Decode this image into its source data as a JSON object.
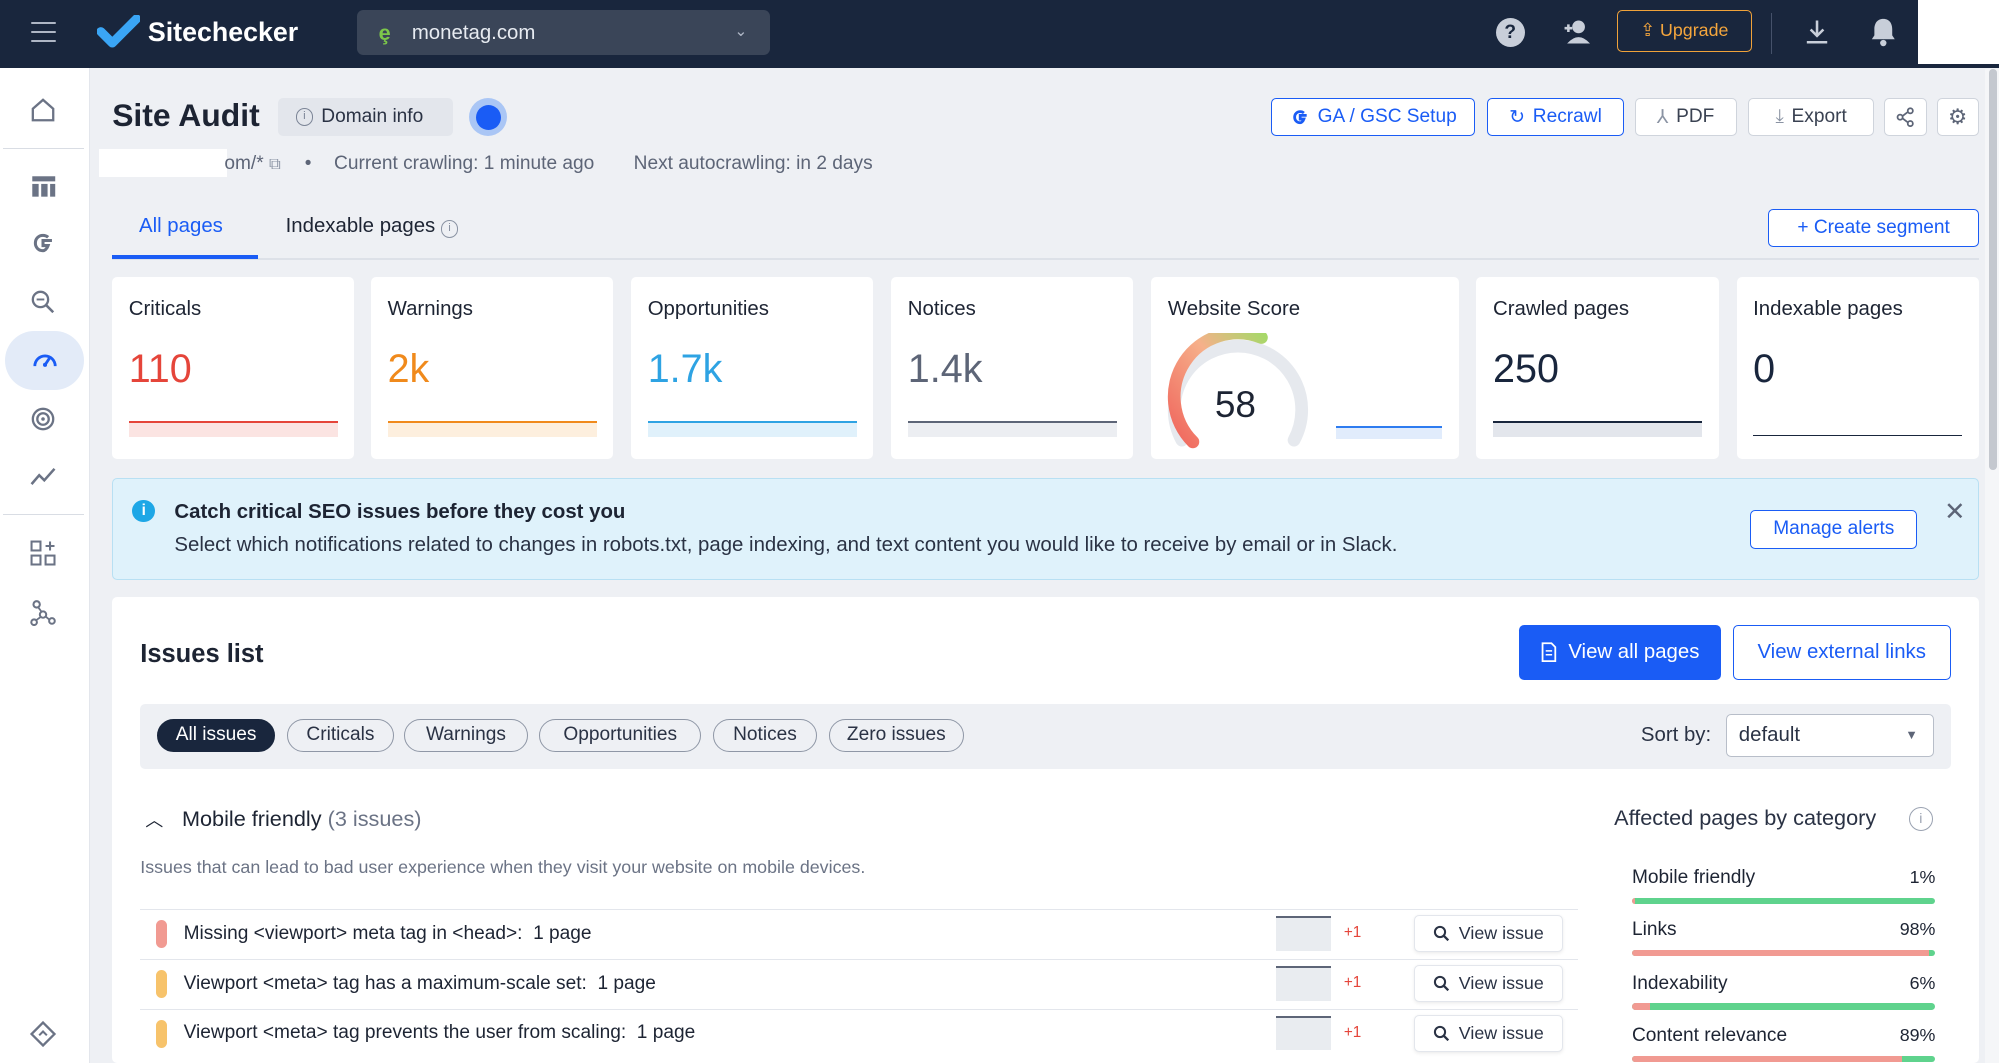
{
  "topbar": {
    "logo_text": "Sitechecker",
    "domain": "monetag.com",
    "upgrade_label": "Upgrade"
  },
  "sidebar": {
    "items": [
      "home-icon",
      "dashboard-icon",
      "google-icon",
      "keyword-search-icon",
      "site-audit-icon",
      "rank-tracker-icon",
      "analytics-icon",
      "apps-icon",
      "network-icon",
      "bottom-diamond-icon"
    ],
    "active_item": "site-audit-icon"
  },
  "header": {
    "title": "Site Audit",
    "domain_info_label": "Domain info",
    "url_suffix": "om/*",
    "current_crawling": "Current crawling: 1 minute ago",
    "next_autocrawling": "Next autocrawling: in 2 days",
    "buttons": {
      "ga_gsc": "GA / GSC Setup",
      "recrawl": "Recrawl",
      "pdf": "PDF",
      "export": "Export"
    }
  },
  "tabs": {
    "all_pages": "All pages",
    "indexable_pages": "Indexable pages",
    "create_segment": "+ Create segment"
  },
  "metrics": [
    {
      "label": "Criticals",
      "value": "110",
      "color": "#e5453a"
    },
    {
      "label": "Warnings",
      "value": "2k",
      "color": "#f08a1c"
    },
    {
      "label": "Opportunities",
      "value": "1.7k",
      "color": "#2ea3e3"
    },
    {
      "label": "Notices",
      "value": "1.4k",
      "color": "#5d6577"
    },
    {
      "label": "Website Score",
      "value": "58",
      "score_fraction": 0.58
    },
    {
      "label": "Crawled pages",
      "value": "250",
      "color": "#19263d"
    },
    {
      "label": "Indexable pages",
      "value": "0",
      "color": "#19263d"
    }
  ],
  "alert": {
    "title": "Catch critical SEO issues before they cost you",
    "text": "Select which notifications related to changes in robots.txt, page indexing, and text content you would like to receive by email or in Slack.",
    "button": "Manage alerts"
  },
  "issues": {
    "title": "Issues list",
    "view_all_pages": "View all pages",
    "view_external_links": "View external links",
    "filters": [
      "All issues",
      "Criticals",
      "Warnings",
      "Opportunities",
      "Notices",
      "Zero issues"
    ],
    "active_filter": "All issues",
    "sort_label": "Sort by:",
    "sort_value": "default",
    "category": {
      "name": "Mobile friendly",
      "count": "(3 issues)",
      "description": "Issues that can lead to bad user experience when they visit your website on mobile devices."
    },
    "rows": [
      {
        "text": "Missing <viewport> meta tag in <head>:",
        "pages": "1 page",
        "delta": "+1",
        "severity_color": "#f19a92",
        "action": "View issue"
      },
      {
        "text": "Viewport <meta> tag has a maximum-scale set:",
        "pages": "1 page",
        "delta": "+1",
        "severity_color": "#f7c36b",
        "action": "View issue"
      },
      {
        "text": "Viewport <meta> tag prevents the user from scaling:",
        "pages": "1 page",
        "delta": "+1",
        "severity_color": "#f7c36b",
        "action": "View issue"
      }
    ]
  },
  "affected": {
    "title": "Affected pages by category",
    "categories": [
      {
        "name": "Mobile friendly",
        "percent": "1%",
        "fraction": 0.01
      },
      {
        "name": "Links",
        "percent": "98%",
        "fraction": 0.98
      },
      {
        "name": "Indexability",
        "percent": "6%",
        "fraction": 0.06
      },
      {
        "name": "Content relevance",
        "percent": "89%",
        "fraction": 0.89
      }
    ]
  }
}
